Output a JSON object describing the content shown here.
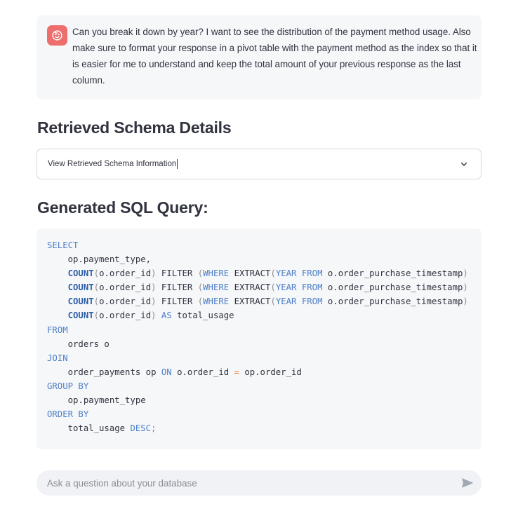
{
  "chat": {
    "user_message": "Can you break it down by year? I want to see the distribution of the payment method usage. Also make sure to format your response in a pivot table with the payment method as the index so that it is easier for me to understand and keep the total amount of your previous response as the last column."
  },
  "schema_section": {
    "heading": "Retrieved Schema Details",
    "expander_label": "View Retrieved Schema Information"
  },
  "sql_section": {
    "heading": "Generated SQL Query:",
    "code_lines": [
      [
        {
          "t": "SELECT",
          "c": "kw"
        }
      ],
      [
        {
          "t": "    op.payment_type,",
          "c": ""
        }
      ],
      [
        {
          "t": "    ",
          "c": ""
        },
        {
          "t": "COUNT",
          "c": "fn"
        },
        {
          "t": "(",
          "c": "punc"
        },
        {
          "t": "o.order_id",
          "c": ""
        },
        {
          "t": ")",
          "c": "punc"
        },
        {
          "t": " FILTER ",
          "c": ""
        },
        {
          "t": "(",
          "c": "punc"
        },
        {
          "t": "WHERE",
          "c": "kw"
        },
        {
          "t": " EXTRACT",
          "c": ""
        },
        {
          "t": "(",
          "c": "punc"
        },
        {
          "t": "YEAR",
          "c": "kw"
        },
        {
          "t": " ",
          "c": ""
        },
        {
          "t": "FROM",
          "c": "kw"
        },
        {
          "t": " o.order_purchase_timestamp",
          "c": ""
        },
        {
          "t": ")",
          "c": "punc"
        }
      ],
      [
        {
          "t": "    ",
          "c": ""
        },
        {
          "t": "COUNT",
          "c": "fn"
        },
        {
          "t": "(",
          "c": "punc"
        },
        {
          "t": "o.order_id",
          "c": ""
        },
        {
          "t": ")",
          "c": "punc"
        },
        {
          "t": " FILTER ",
          "c": ""
        },
        {
          "t": "(",
          "c": "punc"
        },
        {
          "t": "WHERE",
          "c": "kw"
        },
        {
          "t": " EXTRACT",
          "c": ""
        },
        {
          "t": "(",
          "c": "punc"
        },
        {
          "t": "YEAR",
          "c": "kw"
        },
        {
          "t": " ",
          "c": ""
        },
        {
          "t": "FROM",
          "c": "kw"
        },
        {
          "t": " o.order_purchase_timestamp",
          "c": ""
        },
        {
          "t": ")",
          "c": "punc"
        }
      ],
      [
        {
          "t": "    ",
          "c": ""
        },
        {
          "t": "COUNT",
          "c": "fn"
        },
        {
          "t": "(",
          "c": "punc"
        },
        {
          "t": "o.order_id",
          "c": ""
        },
        {
          "t": ")",
          "c": "punc"
        },
        {
          "t": " FILTER ",
          "c": ""
        },
        {
          "t": "(",
          "c": "punc"
        },
        {
          "t": "WHERE",
          "c": "kw"
        },
        {
          "t": " EXTRACT",
          "c": ""
        },
        {
          "t": "(",
          "c": "punc"
        },
        {
          "t": "YEAR",
          "c": "kw"
        },
        {
          "t": " ",
          "c": ""
        },
        {
          "t": "FROM",
          "c": "kw"
        },
        {
          "t": " o.order_purchase_timestamp",
          "c": ""
        },
        {
          "t": ")",
          "c": "punc"
        }
      ],
      [
        {
          "t": "    ",
          "c": ""
        },
        {
          "t": "COUNT",
          "c": "fn"
        },
        {
          "t": "(",
          "c": "punc"
        },
        {
          "t": "o.order_id",
          "c": ""
        },
        {
          "t": ")",
          "c": "punc"
        },
        {
          "t": " ",
          "c": ""
        },
        {
          "t": "AS",
          "c": "kw"
        },
        {
          "t": " total_usage",
          "c": ""
        }
      ],
      [
        {
          "t": "FROM",
          "c": "kw"
        }
      ],
      [
        {
          "t": "    orders o",
          "c": ""
        }
      ],
      [
        {
          "t": "JOIN",
          "c": "kw"
        }
      ],
      [
        {
          "t": "    order_payments op ",
          "c": ""
        },
        {
          "t": "ON",
          "c": "kw"
        },
        {
          "t": " o.order_id ",
          "c": ""
        },
        {
          "t": "=",
          "c": "op"
        },
        {
          "t": " op.order_id",
          "c": ""
        }
      ],
      [
        {
          "t": "GROUP BY",
          "c": "kw"
        }
      ],
      [
        {
          "t": "    op.payment_type",
          "c": ""
        }
      ],
      [
        {
          "t": "ORDER BY",
          "c": "kw"
        }
      ],
      [
        {
          "t": "    total_usage ",
          "c": ""
        },
        {
          "t": "DESC",
          "c": "kw"
        },
        {
          "t": ";",
          "c": "punc"
        }
      ]
    ]
  },
  "chat_input": {
    "placeholder": "Ask a question about your database"
  },
  "icons": {
    "avatar": "face-icon",
    "expander_toggle": "chevron-down-icon",
    "send": "send-icon"
  },
  "colors": {
    "avatar_bg": "#ec6f6e",
    "keyword": "#4c7ec8",
    "function": "#2d5ea8",
    "operator": "#e27b2f",
    "panel_bg": "#f6f7f9",
    "input_bg": "#f0f2f6"
  }
}
